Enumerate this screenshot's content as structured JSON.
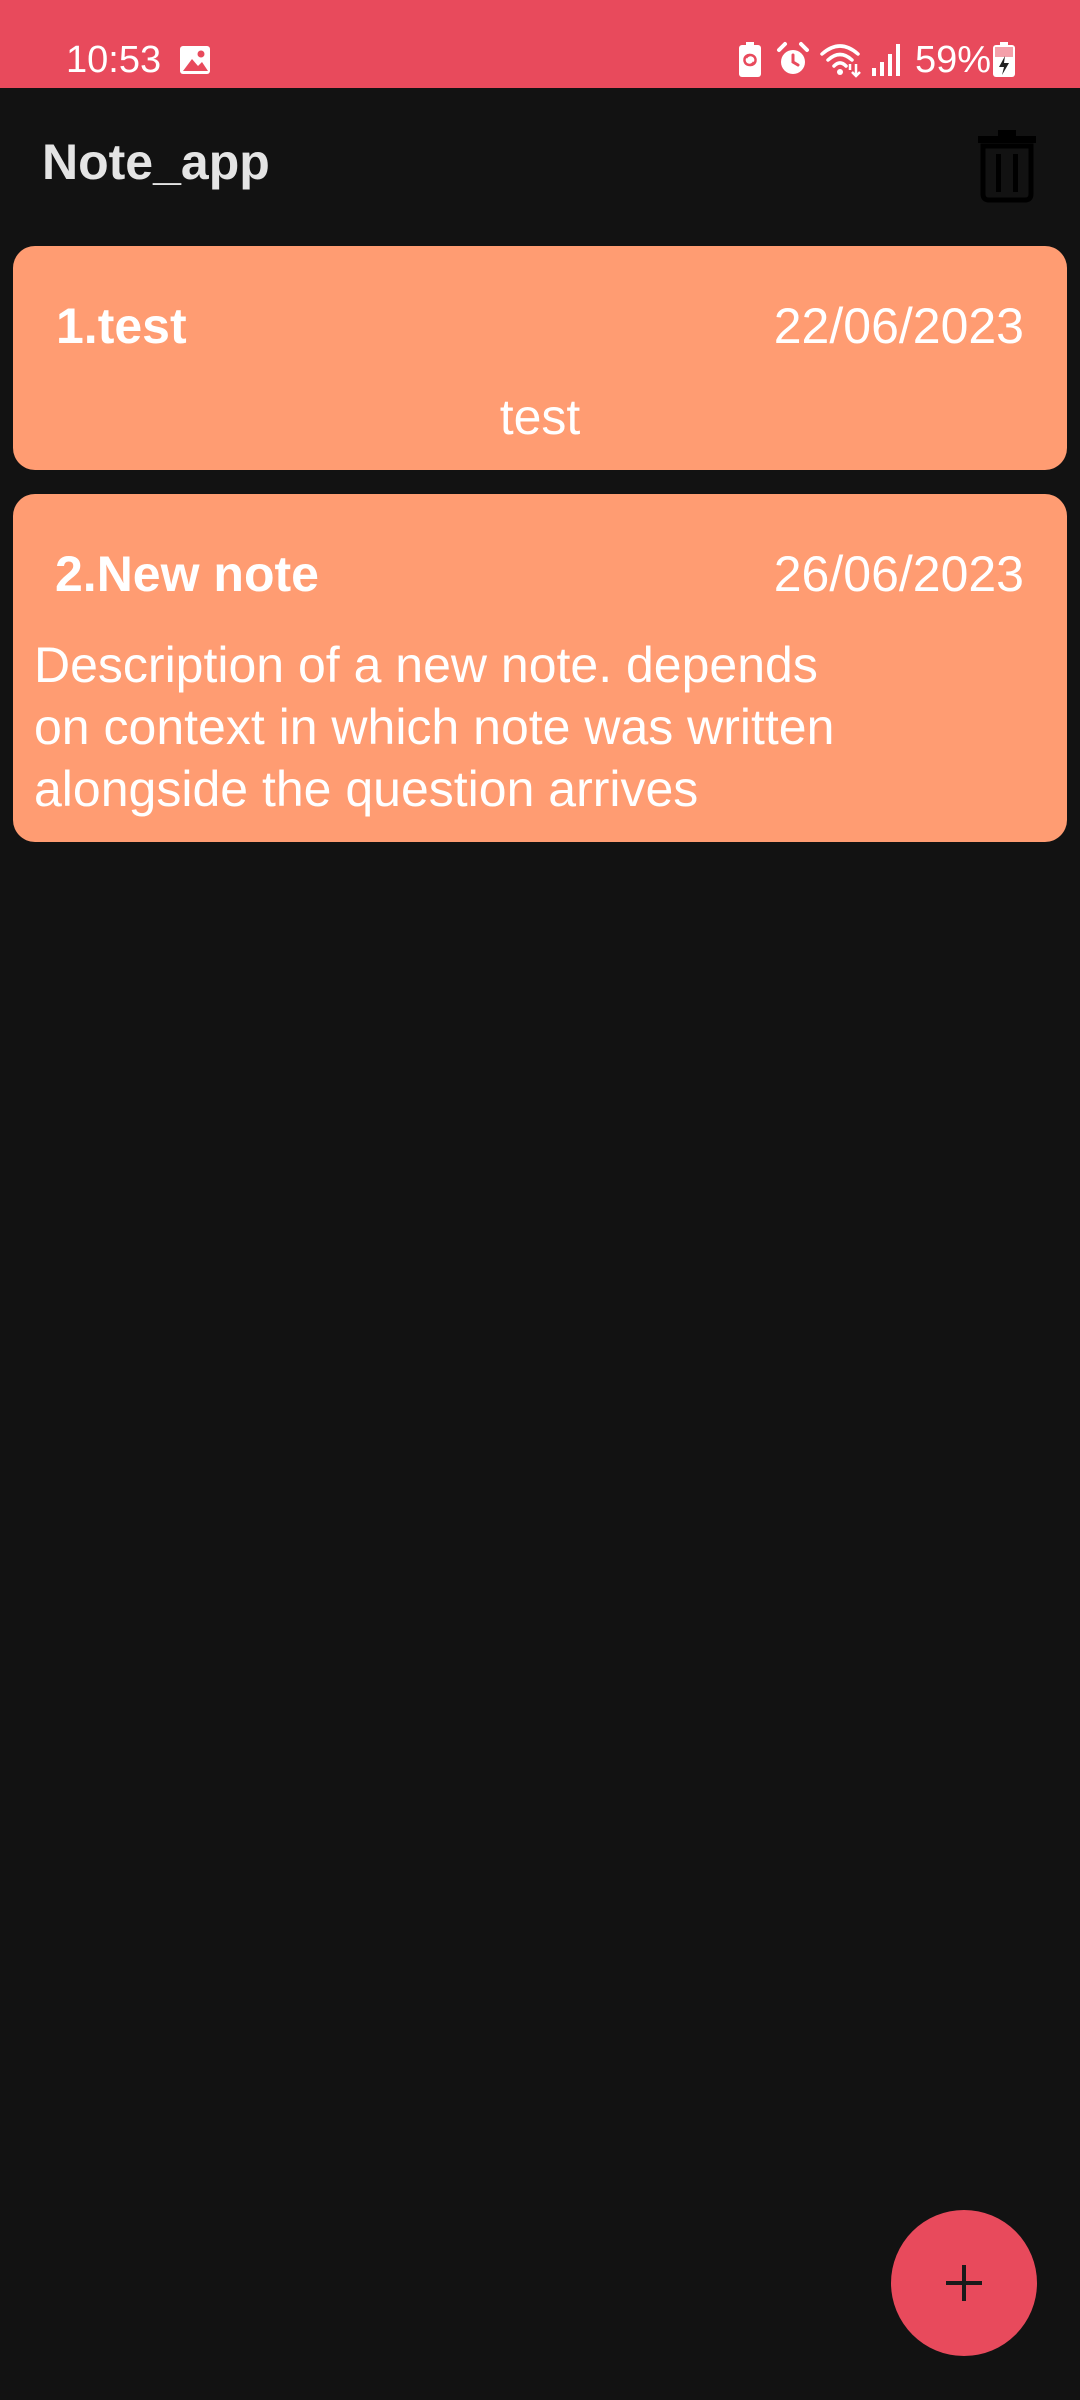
{
  "status_bar": {
    "time": "10:53",
    "battery_percent": "59%",
    "icons": [
      "gallery-icon",
      "battery-saver-icon",
      "alarm-icon",
      "wifi-icon",
      "signal-icon",
      "battery-charging-icon"
    ],
    "background_color": "#e84a5c"
  },
  "app_bar": {
    "title": "Note_app",
    "delete_icon": "trash-icon"
  },
  "notes": [
    {
      "title": "1.test",
      "date": "22/06/2023",
      "description": "test"
    },
    {
      "title": "2.New note",
      "date": "26/06/2023",
      "description_lines": [
        "Description of a new note. depends",
        "on context in which note was written",
        "alongside the question arrives"
      ]
    }
  ],
  "fab": {
    "icon": "plus-icon"
  },
  "colors": {
    "background": "#121212",
    "card": "#ff9c72",
    "accent": "#e84a5c",
    "title_text": "#e4e4e4"
  }
}
